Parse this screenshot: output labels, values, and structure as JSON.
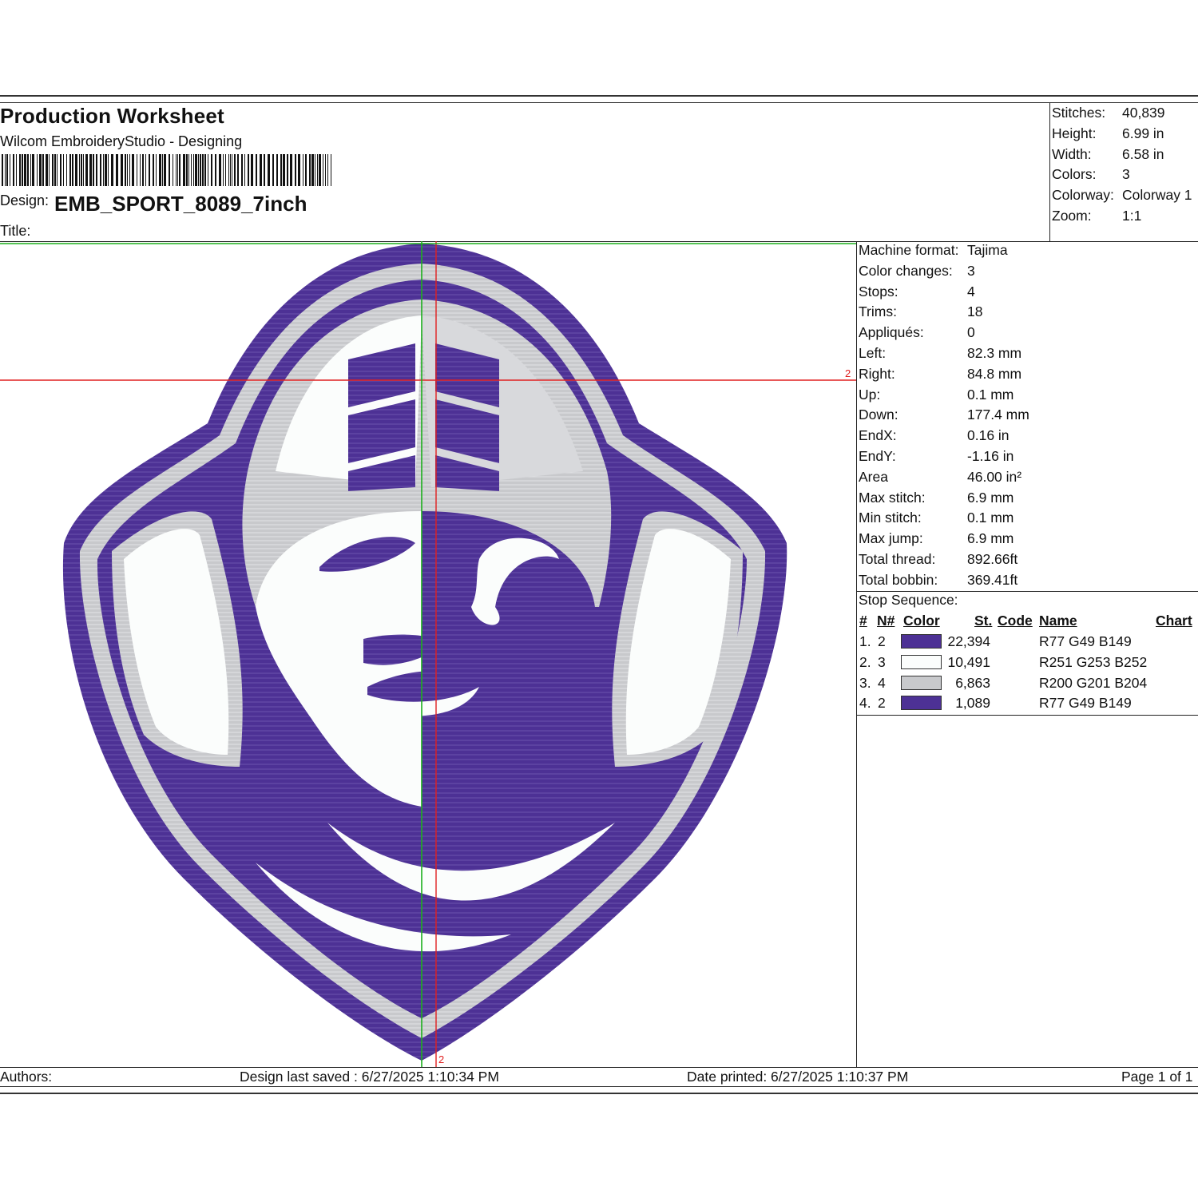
{
  "header": {
    "title": "Production Worksheet",
    "subtitle": "Wilcom EmbroideryStudio - Designing",
    "design_label": "Design:",
    "design_name": "EMB_SPORT_8089_7inch",
    "title_label": "Title:"
  },
  "summary": [
    {
      "key": "Stitches:",
      "value": "40,839"
    },
    {
      "key": "Height:",
      "value": "6.99 in"
    },
    {
      "key": "Width:",
      "value": "6.58 in"
    },
    {
      "key": "Colors:",
      "value": "3"
    },
    {
      "key": "Colorway:",
      "value": "Colorway 1"
    },
    {
      "key": "Zoom:",
      "value": "1:1"
    }
  ],
  "machine": [
    {
      "key": "Machine format:",
      "value": "Tajima"
    },
    {
      "key": "Color changes:",
      "value": "3"
    },
    {
      "key": "Stops:",
      "value": "4"
    },
    {
      "key": "Trims:",
      "value": "18"
    },
    {
      "key": "Appliqués:",
      "value": "0"
    },
    {
      "key": "Left:",
      "value": "82.3 mm"
    },
    {
      "key": "Right:",
      "value": "84.8 mm"
    },
    {
      "key": "Up:",
      "value": "0.1 mm"
    },
    {
      "key": "Down:",
      "value": "177.4 mm"
    },
    {
      "key": "EndX:",
      "value": "0.16 in"
    },
    {
      "key": "EndY:",
      "value": "-1.16 in"
    },
    {
      "key": "Area",
      "value": " 46.00 in²"
    },
    {
      "key": "Max stitch:",
      "value": "6.9 mm"
    },
    {
      "key": "Min stitch:",
      "value": "0.1 mm"
    },
    {
      "key": "Max jump:",
      "value": "6.9 mm"
    },
    {
      "key": "Total thread:",
      "value": "892.66ft"
    },
    {
      "key": "Total bobbin:",
      "value": "369.41ft"
    }
  ],
  "stop_sequence": {
    "title": "Stop Sequence:",
    "columns": {
      "num": "#",
      "needle": "N#",
      "color": "Color",
      "stitches": "St.",
      "code": "Code",
      "name": "Name",
      "chart": "Chart"
    },
    "rows": [
      {
        "num": "1.",
        "needle": "2",
        "stitches": "22,394",
        "name": "R77 G49 B149",
        "color": "#4d3195"
      },
      {
        "num": "2.",
        "needle": "3",
        "stitches": "10,491",
        "name": "R251 G253 B252",
        "color": "#fbfdfc"
      },
      {
        "num": "3.",
        "needle": "4",
        "stitches": "6,863",
        "name": "R200 G201 B204",
        "color": "#c8c9cc"
      },
      {
        "num": "4.",
        "needle": "2",
        "stitches": "1,089",
        "name": "R77 G49 B149",
        "color": "#4d3195"
      }
    ]
  },
  "guides": {
    "right_marker": "2",
    "bottom_marker": "2"
  },
  "footer": {
    "authors": "Authors:",
    "saved": "Design last saved : 6/27/2025 1:10:34 PM",
    "printed": "Date printed: 6/27/2025 1:10:37 PM",
    "page": "Page 1 of 1"
  },
  "colors": {
    "purple": "#4d3195",
    "white": "#fbfdfc",
    "silver": "#c8c9cc",
    "guide_red": "#e02020",
    "guide_green": "#1db01d"
  },
  "image": {
    "subject": "purple-shield-warrior-embroidery"
  }
}
